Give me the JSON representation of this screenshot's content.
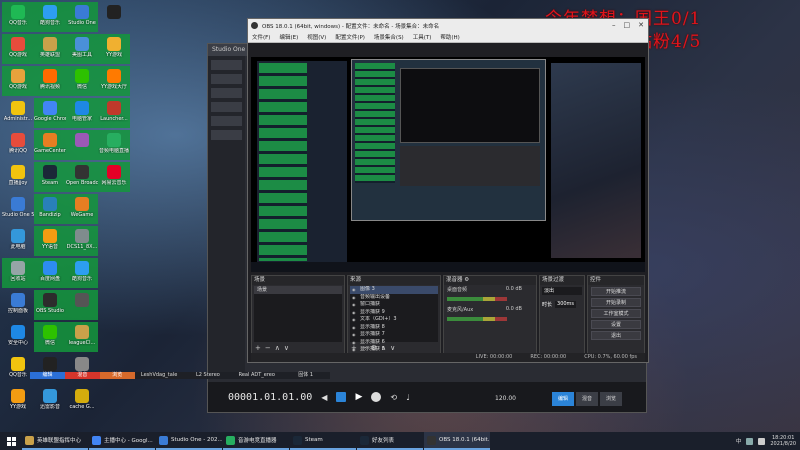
{
  "overlay": {
    "line1": "今年梦想：国王0/1",
    "line2": "今日梦想：钻粉4/5"
  },
  "desktop_icons": [
    {
      "label": "QQ音乐",
      "color": "#1fb954",
      "selected": true
    },
    {
      "label": "酷狗音乐",
      "color": "#2d9ef0",
      "selected": true
    },
    {
      "label": "Studio One",
      "color": "#3a7bd5",
      "selected": true
    },
    {
      "label": "",
      "color": "#222222",
      "selected": false
    },
    {
      "label": "QQ游戏",
      "color": "#e74c3c",
      "selected": true
    },
    {
      "label": "英雄联盟",
      "color": "#caa14a",
      "selected": true
    },
    {
      "label": "美图工具",
      "color": "#4a90d9",
      "selected": true
    },
    {
      "label": "YY游戏",
      "color": "#f0b030",
      "selected": true
    },
    {
      "label": "QQ游戏",
      "color": "#e7a23c",
      "selected": true
    },
    {
      "label": "腾讯视频",
      "color": "#ff6a00",
      "selected": true
    },
    {
      "label": "微信",
      "color": "#2dc100",
      "selected": true
    },
    {
      "label": "YY游戏大厅",
      "color": "#ff7a00",
      "selected": true
    },
    {
      "label": "Administr...",
      "color": "#f1c40f",
      "selected": false
    },
    {
      "label": "Google Chrome",
      "color": "#4285f4",
      "selected": true
    },
    {
      "label": "电脑管家",
      "color": "#1e88e5",
      "selected": true
    },
    {
      "label": "Launcher...",
      "color": "#c0392b",
      "selected": true
    },
    {
      "label": "腾讯QQ",
      "color": "#e74c3c",
      "selected": false
    },
    {
      "label": "GameCenter",
      "color": "#e67e22",
      "selected": true
    },
    {
      "label": "",
      "color": "#9b59b6",
      "selected": true
    },
    {
      "label": "音频电脑直播",
      "color": "#27ae60",
      "selected": true
    },
    {
      "label": "直播jjoy",
      "color": "#f1c40f",
      "selected": false
    },
    {
      "label": "Steam",
      "color": "#1b2838",
      "selected": true
    },
    {
      "label": "Open Broadcast",
      "color": "#333333",
      "selected": true
    },
    {
      "label": "网易云音乐",
      "color": "#e60026",
      "selected": true
    },
    {
      "label": "Studio One 5",
      "color": "#3a7bd5",
      "selected": false
    },
    {
      "label": "Bandizip",
      "color": "#2980b9",
      "selected": true
    },
    {
      "label": "WeGame",
      "color": "#e67e22",
      "selected": true
    },
    {
      "label": "",
      "color": "",
      "selected": false
    },
    {
      "label": "此电脑",
      "color": "#3498db",
      "selected": false
    },
    {
      "label": "YY语音",
      "color": "#f39c12",
      "selected": true
    },
    {
      "label": "DCS11_8X...",
      "color": "#7f8c8d",
      "selected": true
    },
    {
      "label": "",
      "color": "",
      "selected": false
    },
    {
      "label": "回收站",
      "color": "#95a5a6",
      "selected": true
    },
    {
      "label": "百度网盘",
      "color": "#2d8cf0",
      "selected": true
    },
    {
      "label": "酷狗音乐",
      "color": "#2d9ef0",
      "selected": true
    },
    {
      "label": "",
      "color": "",
      "selected": false
    },
    {
      "label": "控制面板",
      "color": "#3a7bd5",
      "selected": false
    },
    {
      "label": "OBS Studio",
      "color": "#2c2c2c",
      "selected": true
    },
    {
      "label": "",
      "color": "#555555",
      "selected": true
    },
    {
      "label": "",
      "color": "",
      "selected": false
    },
    {
      "label": "安全中心",
      "color": "#1e88e5",
      "selected": false
    },
    {
      "label": "微信",
      "color": "#2dc100",
      "selected": true
    },
    {
      "label": "leagueCl...",
      "color": "#caa14a",
      "selected": true
    },
    {
      "label": "",
      "color": "",
      "selected": false
    },
    {
      "label": "QQ音乐",
      "color": "#f1c40f",
      "selected": false
    },
    {
      "label": "",
      "color": "#222222",
      "selected": false
    },
    {
      "label": "ReadHugu...",
      "color": "#888888",
      "selected": false
    },
    {
      "label": "",
      "color": "",
      "selected": false
    },
    {
      "label": "YY游戏",
      "color": "#f39c12",
      "selected": false
    },
    {
      "label": "迅雷影音",
      "color": "#3498db",
      "selected": false
    },
    {
      "label": "cache G...",
      "color": "#d4ac0d",
      "selected": false
    }
  ],
  "daw": {
    "title": "Studio One",
    "timecode": "00001.01.01.00",
    "tempo": "120.00",
    "color_strip": [
      {
        "label": "编辑",
        "color": "#2b6fd6"
      },
      {
        "label": "混音",
        "color": "#d6352b"
      },
      {
        "label": "浏览",
        "color": "#d66a2b"
      },
      {
        "label": "LeshVdag_tale",
        "color": ""
      },
      {
        "label": "L2 Stereo",
        "color": ""
      },
      {
        "label": "Real ADT_ereo",
        "color": ""
      },
      {
        "label": "固体 1",
        "color": ""
      }
    ],
    "tabs": [
      "编辑",
      "混音",
      "浏览"
    ]
  },
  "obs": {
    "title": "OBS 18.0.1 (64bit, windows) - 配置文件：未命名 - 场景集合：未命名",
    "menu": [
      "文件(F)",
      "编辑(E)",
      "视图(V)",
      "配置文件(P)",
      "场景集合(S)",
      "工具(T)",
      "帮助(H)"
    ],
    "docks": {
      "scenes_title": "场景",
      "sources_title": "来源",
      "mixer_title": "混音器",
      "transitions_title": "场景过渡",
      "controls_title": "控件"
    },
    "scenes": [
      "场景"
    ],
    "sources": [
      "图像 3",
      "音频输出设备",
      "窗口捕获",
      "显示捕获 9",
      "文本（GDI+）3",
      "显示捕获 8",
      "显示捕获 7",
      "显示捕获 6",
      "显示捕获 5"
    ],
    "mixer": [
      {
        "name": "桌面音频",
        "db": "0.0 dB"
      },
      {
        "name": "麦克风/Aux",
        "db": "0.0 dB"
      }
    ],
    "transition_mode": "淡出",
    "transition_duration_label": "时长",
    "transition_duration": "300ms",
    "controls": [
      "开始推流",
      "开始录制",
      "工作室模式",
      "设置",
      "退出"
    ],
    "status": {
      "live": "LIVE: 00:00:00",
      "rec": "REC: 00:00:00",
      "cpu": "CPU: 0.7%, 60.00 fps"
    }
  },
  "taskbar": {
    "items": [
      {
        "label": "英雄联盟指挥中心",
        "color": "#caa14a"
      },
      {
        "label": "主播中心 - Googl...",
        "color": "#4285f4"
      },
      {
        "label": "Studio One - 202...",
        "color": "#3a7bd5"
      },
      {
        "label": "音游电竞直播器",
        "color": "#27ae60"
      },
      {
        "label": "Steam",
        "color": "#1b2838"
      },
      {
        "label": "好友列表",
        "color": "#1b2838"
      },
      {
        "label": "OBS 18.0.1 (64bit...",
        "color": "#333333"
      }
    ],
    "time": "18:20:01",
    "date": "2021/8/20",
    "ime": "中"
  }
}
